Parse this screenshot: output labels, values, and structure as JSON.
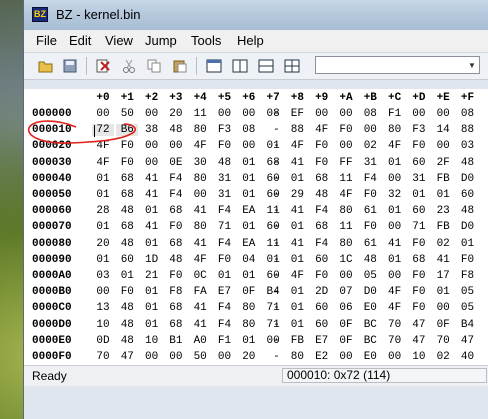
{
  "window": {
    "title": "BZ - kernel.bin",
    "app_icon_text": "BZ"
  },
  "menu": [
    "File",
    "Edit",
    "View",
    "Jump",
    "Tools",
    "Help"
  ],
  "toolbar": {
    "icons": [
      "open-icon",
      "save-icon",
      "compare-icon",
      "cut-icon",
      "copy-icon",
      "paste-icon",
      "view-single-icon",
      "view-split-vertical-icon",
      "view-split-horizontal-icon",
      "view-grid-icon"
    ],
    "combo_value": ""
  },
  "hex": {
    "columns": [
      "+0",
      "+1",
      "+2",
      "+3",
      "+4",
      "+5",
      "+6",
      "+7",
      "+8",
      "+9",
      "+A",
      "+B",
      "+C",
      "+D",
      "+E",
      "+F"
    ],
    "rows": [
      {
        "addr": "000000",
        "bytes": [
          "00",
          "50",
          "00",
          "20",
          "11",
          "00",
          "00",
          "08",
          "EF",
          "00",
          "00",
          "08",
          "F1",
          "00",
          "00",
          "08"
        ]
      },
      {
        "addr": "000010",
        "bytes": [
          "72",
          "B6",
          "38",
          "48",
          "80",
          "F3",
          "08",
          "88",
          "4F",
          "F0",
          "00",
          "80",
          "F3",
          "14",
          "88"
        ]
      },
      {
        "addr": "000020",
        "bytes": [
          "4F",
          "F0",
          "00",
          "00",
          "4F",
          "F0",
          "00",
          "01",
          "4F",
          "F0",
          "00",
          "02",
          "4F",
          "F0",
          "00",
          "03"
        ]
      },
      {
        "addr": "000030",
        "bytes": [
          "4F",
          "F0",
          "00",
          "0E",
          "30",
          "48",
          "01",
          "68",
          "41",
          "F0",
          "FF",
          "31",
          "01",
          "60",
          "2F",
          "48"
        ]
      },
      {
        "addr": "000040",
        "bytes": [
          "01",
          "68",
          "41",
          "F4",
          "80",
          "31",
          "01",
          "60",
          "01",
          "68",
          "11",
          "F4",
          "00",
          "31",
          "FB",
          "D0"
        ]
      },
      {
        "addr": "000050",
        "bytes": [
          "01",
          "68",
          "41",
          "F4",
          "00",
          "31",
          "01",
          "60",
          "29",
          "48",
          "4F",
          "F0",
          "32",
          "01",
          "01",
          "60"
        ]
      },
      {
        "addr": "000060",
        "bytes": [
          "28",
          "48",
          "01",
          "68",
          "41",
          "F4",
          "EA",
          "11",
          "41",
          "F4",
          "80",
          "61",
          "01",
          "60",
          "23",
          "48"
        ]
      },
      {
        "addr": "000070",
        "bytes": [
          "01",
          "68",
          "41",
          "F0",
          "80",
          "71",
          "01",
          "60",
          "01",
          "68",
          "11",
          "F0",
          "00",
          "71",
          "FB",
          "D0"
        ]
      },
      {
        "addr": "000080",
        "bytes": [
          "20",
          "48",
          "01",
          "68",
          "41",
          "F4",
          "EA",
          "11",
          "41",
          "F4",
          "80",
          "61",
          "41",
          "F0",
          "02",
          "01"
        ]
      },
      {
        "addr": "000090",
        "bytes": [
          "01",
          "60",
          "1D",
          "48",
          "4F",
          "F0",
          "04",
          "01",
          "01",
          "60",
          "1C",
          "48",
          "01",
          "68",
          "41",
          "F0"
        ]
      },
      {
        "addr": "0000A0",
        "bytes": [
          "03",
          "01",
          "21",
          "F0",
          "0C",
          "01",
          "01",
          "60",
          "4F",
          "F0",
          "00",
          "05",
          "00",
          "F0",
          "17",
          "F8"
        ]
      },
      {
        "addr": "0000B0",
        "bytes": [
          "00",
          "F0",
          "01",
          "F8",
          "FA",
          "E7",
          "0F",
          "B4",
          "01",
          "2D",
          "07",
          "D0",
          "4F",
          "F0",
          "01",
          "05"
        ]
      },
      {
        "addr": "0000C0",
        "bytes": [
          "13",
          "48",
          "01",
          "68",
          "41",
          "F4",
          "80",
          "71",
          "01",
          "60",
          "06",
          "E0",
          "4F",
          "F0",
          "00",
          "05"
        ]
      },
      {
        "addr": "0000D0",
        "bytes": [
          "10",
          "48",
          "01",
          "68",
          "41",
          "F4",
          "80",
          "71",
          "01",
          "60",
          "0F",
          "BC",
          "70",
          "47",
          "0F",
          "B4"
        ]
      },
      {
        "addr": "0000E0",
        "bytes": [
          "0D",
          "48",
          "10",
          "B1",
          "A0",
          "F1",
          "01",
          "00",
          "FB",
          "E7",
          "0F",
          "BC",
          "70",
          "47",
          "70",
          "47"
        ]
      },
      {
        "addr": "0000F0",
        "bytes": [
          "70",
          "47",
          "00",
          "00",
          "50",
          "00",
          "20",
          "80",
          "E2",
          "00",
          "E0",
          "00",
          "10",
          "02",
          "40"
        ]
      }
    ],
    "row1_partial_after_col7": true
  },
  "status": {
    "left": "Ready",
    "right": "000010: 0x72 (114)"
  },
  "colors": {
    "annotation": "#e0201a",
    "title_bg": "#b9cadd"
  }
}
